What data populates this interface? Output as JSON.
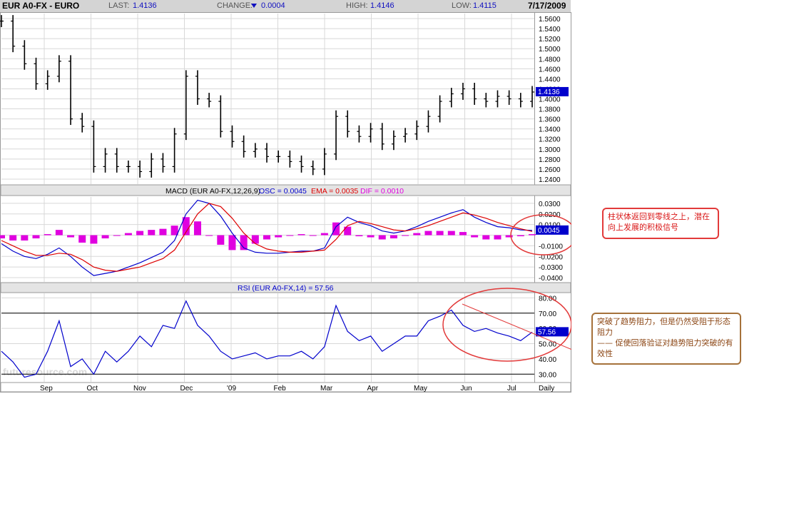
{
  "header": {
    "symbol": "EUR A0-FX - EURO",
    "last_label": "LAST:",
    "last_value": "1.4136",
    "change_label": "CHANGE:",
    "change_icon": "down-triangle-icon",
    "change_value": "0.0004",
    "high_label": "HIGH:",
    "high_value": "1.4146",
    "low_label": "LOW:",
    "low_value": "1.4115",
    "date": "7/17/2009"
  },
  "macd_legend": {
    "title": "MACD (EUR A0-FX,12,26,9)",
    "osc": "OSC = 0.0045",
    "ema": "EMA = 0.0035",
    "dif": "DIF = 0.0010"
  },
  "rsi_legend": {
    "title": "RSI (EUR A0-FX,14) = 57.56"
  },
  "watermark": "futuresource.com",
  "annotations": {
    "note1": "柱状体返回到零线之上，潜在向上发展的积极信号",
    "note2_line1": "突破了趋势阻力，但是仍然受阻于形态阻力",
    "note2_line2": "—— 促使回落验证对趋势阻力突破的有效性"
  },
  "colors": {
    "panel_bg": "#ffffff",
    "header_bg": "#d4d4d4",
    "price": "#000000",
    "osc_blue": "#0000cc",
    "ema_red": "#dd0000",
    "dif_magenta": "#e000e0",
    "annotation_red": "#e23a3a",
    "annotation_brown": "#a5713a",
    "highlight_box": "#0000cc"
  },
  "chart_data": [
    {
      "type": "ohlc",
      "panel": "price",
      "title": "EUR A0-FX - EURO",
      "frequency": "Daily",
      "x": [
        "2008-08-25",
        "2008-09-01",
        "2008-09-08",
        "2008-09-15",
        "2008-09-22",
        "2008-09-29",
        "2008-10-06",
        "2008-10-13",
        "2008-10-20",
        "2008-10-27",
        "2008-11-03",
        "2008-11-10",
        "2008-11-17",
        "2008-11-24",
        "2008-12-01",
        "2008-12-08",
        "2008-12-15",
        "2008-12-22",
        "2008-12-29",
        "2009-01-05",
        "2009-01-12",
        "2009-01-19",
        "2009-01-26",
        "2009-02-02",
        "2009-02-09",
        "2009-02-16",
        "2009-02-23",
        "2009-03-02",
        "2009-03-09",
        "2009-03-16",
        "2009-03-23",
        "2009-03-30",
        "2009-04-06",
        "2009-04-13",
        "2009-04-20",
        "2009-04-27",
        "2009-05-04",
        "2009-05-11",
        "2009-05-18",
        "2009-05-25",
        "2009-06-01",
        "2009-06-08",
        "2009-06-15",
        "2009-06-22",
        "2009-06-29",
        "2009-07-06",
        "2009-07-13"
      ],
      "close": [
        1.555,
        1.505,
        1.47,
        1.43,
        1.445,
        1.475,
        1.36,
        1.345,
        1.265,
        1.29,
        1.265,
        1.265,
        1.255,
        1.28,
        1.265,
        1.33,
        1.445,
        1.4,
        1.395,
        1.335,
        1.315,
        1.295,
        1.3,
        1.285,
        1.285,
        1.275,
        1.265,
        1.26,
        1.29,
        1.365,
        1.335,
        1.325,
        1.34,
        1.31,
        1.325,
        1.33,
        1.345,
        1.365,
        1.395,
        1.41,
        1.42,
        1.4,
        1.395,
        1.405,
        1.4,
        1.395,
        1.4136
      ],
      "x_ticks": [
        "Sep",
        "Oct",
        "Nov",
        "Dec",
        "'09",
        "Feb",
        "Mar",
        "Apr",
        "May",
        "Jun",
        "Jul",
        "Daily"
      ],
      "y_ticks": [
        1.24,
        1.26,
        1.28,
        1.3,
        1.32,
        1.34,
        1.36,
        1.38,
        1.4,
        1.42,
        1.44,
        1.46,
        1.48,
        1.5,
        1.52,
        1.54,
        1.56
      ],
      "ylim": [
        1.23,
        1.57
      ],
      "last_value_label": "1.4136"
    },
    {
      "type": "line+histogram",
      "panel": "macd",
      "series": [
        {
          "name": "OSC",
          "color": "#0000cc",
          "values": [
            -0.008,
            -0.015,
            -0.02,
            -0.022,
            -0.018,
            -0.012,
            -0.02,
            -0.03,
            -0.038,
            -0.036,
            -0.034,
            -0.03,
            -0.026,
            -0.021,
            -0.016,
            -0.005,
            0.02,
            0.033,
            0.03,
            0.018,
            0.002,
            -0.012,
            -0.016,
            -0.017,
            -0.017,
            -0.016,
            -0.015,
            -0.015,
            -0.012,
            0.008,
            0.017,
            0.012,
            0.009,
            0.004,
            0.002,
            0.004,
            0.008,
            0.013,
            0.017,
            0.021,
            0.024,
            0.017,
            0.012,
            0.008,
            0.007,
            0.005,
            0.0045
          ]
        },
        {
          "name": "EMA",
          "color": "#dd0000",
          "values": [
            -0.005,
            -0.01,
            -0.015,
            -0.019,
            -0.019,
            -0.017,
            -0.018,
            -0.023,
            -0.03,
            -0.033,
            -0.034,
            -0.032,
            -0.03,
            -0.026,
            -0.022,
            -0.014,
            0.003,
            0.02,
            0.03,
            0.027,
            0.016,
            0.002,
            -0.008,
            -0.013,
            -0.015,
            -0.016,
            -0.016,
            -0.015,
            -0.014,
            -0.004,
            0.009,
            0.013,
            0.011,
            0.008,
            0.005,
            0.004,
            0.006,
            0.009,
            0.013,
            0.017,
            0.021,
            0.019,
            0.016,
            0.012,
            0.009,
            0.006,
            0.0035
          ]
        },
        {
          "name": "DIF",
          "color": "#e000e0",
          "values": [
            -0.003,
            -0.005,
            -0.005,
            -0.003,
            0.001,
            0.005,
            -0.002,
            -0.007,
            -0.008,
            -0.003,
            0.0,
            0.002,
            0.004,
            0.005,
            0.006,
            0.009,
            0.017,
            0.013,
            0.0,
            -0.009,
            -0.014,
            -0.014,
            -0.008,
            -0.004,
            -0.002,
            0.0,
            0.001,
            0.0,
            0.002,
            0.012,
            0.008,
            -0.001,
            -0.002,
            -0.004,
            -0.003,
            0.0,
            0.002,
            0.004,
            0.004,
            0.004,
            0.003,
            -0.002,
            -0.004,
            -0.004,
            -0.002,
            -0.001,
            0.001
          ]
        }
      ],
      "y_ticks": [
        -0.04,
        -0.03,
        -0.02,
        -0.01,
        0.0,
        0.01,
        0.02,
        0.03
      ],
      "y_tick_labels": [
        "-0.0400",
        "-0.0300",
        "-0.0200",
        "-0.0100",
        "",
        "0.0100",
        "0.0200",
        "0.0300"
      ],
      "ylim": [
        -0.044,
        0.036
      ],
      "last_value_label": "0.0045"
    },
    {
      "type": "line",
      "panel": "rsi",
      "series": [
        {
          "name": "RSI",
          "color": "#0000cc",
          "values": [
            45,
            38,
            28,
            30,
            45,
            65,
            35,
            40,
            30,
            45,
            38,
            45,
            55,
            48,
            62,
            60,
            78,
            62,
            55,
            45,
            40,
            42,
            44,
            40,
            42,
            42,
            45,
            40,
            48,
            75,
            58,
            52,
            55,
            45,
            50,
            55,
            55,
            65,
            68,
            72,
            62,
            58,
            60,
            57,
            55,
            52,
            57.56
          ]
        }
      ],
      "reference_lines": [
        30,
        70
      ],
      "y_ticks": [
        30,
        40,
        50,
        60,
        70,
        80
      ],
      "y_tick_labels": [
        "30.00",
        "40.00",
        "50.00",
        "60.00",
        "70.00",
        "80.00"
      ],
      "ylim": [
        25,
        83
      ],
      "last_value_label": "57.56"
    }
  ]
}
